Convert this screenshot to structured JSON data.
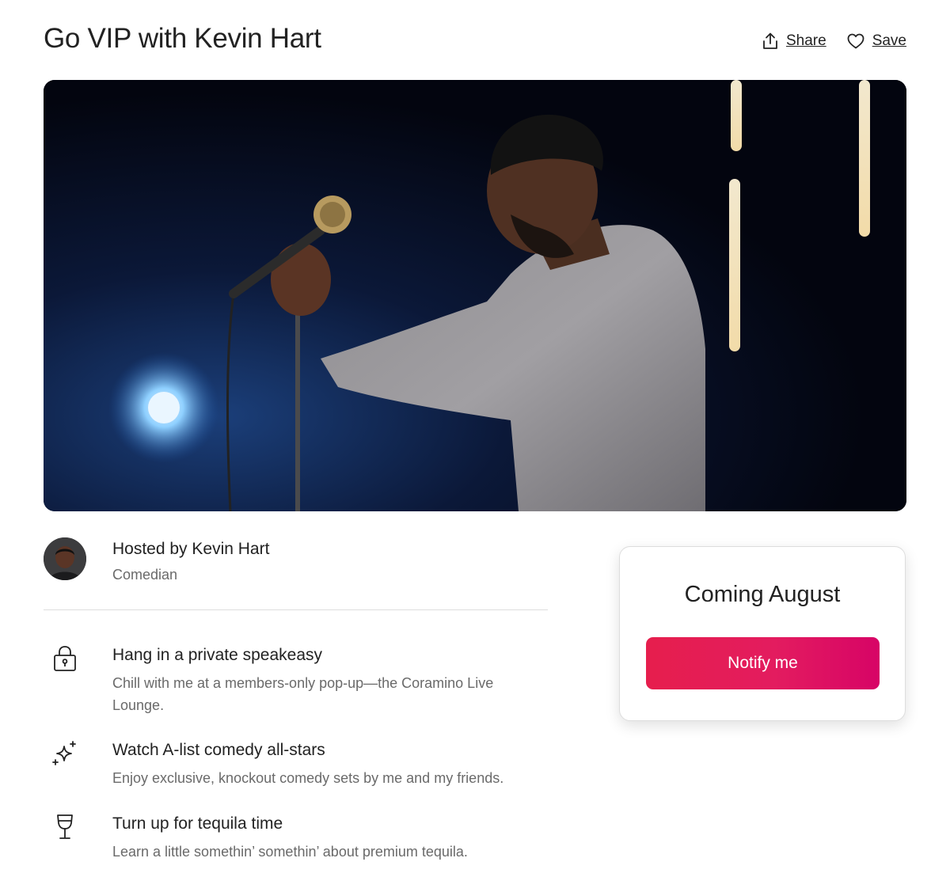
{
  "header": {
    "title": "Go VIP with Kevin Hart",
    "share_label": "Share",
    "save_label": "Save"
  },
  "hero": {
    "image_subject": "comedian holding microphone on stage"
  },
  "host": {
    "name": "Hosted by Kevin Hart",
    "role": "Comedian"
  },
  "features": [
    {
      "icon": "lock-icon",
      "title": "Hang in a private speakeasy",
      "description": "Chill with me at a members-only pop-up—the Coramino Live Lounge."
    },
    {
      "icon": "sparkles-icon",
      "title": "Watch A-list comedy all-stars",
      "description": "Enjoy exclusive, knockout comedy sets by me and my friends."
    },
    {
      "icon": "wine-glass-icon",
      "title": "Turn up for tequila time",
      "description": "Learn a little somethin’ somethin’ about premium tequila."
    }
  ],
  "booking": {
    "status": "Coming August",
    "button_label": "Notify me"
  },
  "colors": {
    "accent_start": "#e61e4d",
    "accent_end": "#d70466",
    "text_primary": "#222222",
    "text_secondary": "#6a6a6a",
    "divider": "#dddddd"
  }
}
